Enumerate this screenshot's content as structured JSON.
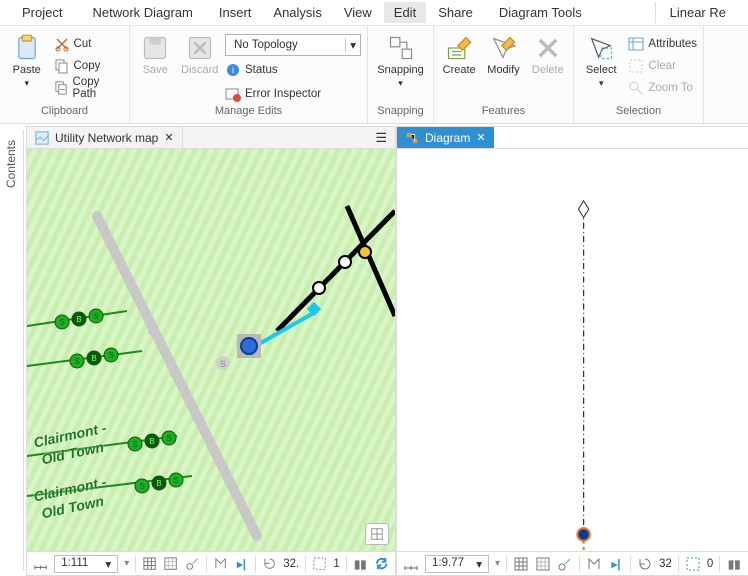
{
  "menu": {
    "items": [
      "Project",
      "Network Diagram",
      "Insert",
      "Analysis",
      "View",
      "Edit",
      "Share",
      "Diagram Tools",
      "Linear Re"
    ]
  },
  "ribbon": {
    "clipboard": {
      "paste": "Paste",
      "cut": "Cut",
      "copy": "Copy",
      "copy_path": "Copy Path",
      "label": "Clipboard"
    },
    "manage": {
      "save": "Save",
      "discard": "Discard",
      "topology": "No Topology",
      "status": "Status",
      "error_inspector": "Error Inspector",
      "label": "Manage Edits"
    },
    "snapping": {
      "snapping": "Snapping",
      "label": "Snapping"
    },
    "features": {
      "create": "Create",
      "modify": "Modify",
      "delete": "Delete",
      "label": "Features"
    },
    "selection": {
      "select": "Select",
      "attributes": "Attributes",
      "clear": "Clear",
      "zoom_to": "Zoom To",
      "label": "Selection"
    }
  },
  "contents": {
    "label": "Contents"
  },
  "left_pane": {
    "tab": "Utility Network map",
    "scale": "1:111",
    "towns": [
      "Clairmont -",
      "Old Town",
      "Clairmont -",
      "Old Town"
    ],
    "rot_left": "32.",
    "rot_right": "1"
  },
  "right_pane": {
    "tab": "Diagram",
    "scale": "1:9.77",
    "rot_left": "32",
    "rot_right": "0"
  }
}
